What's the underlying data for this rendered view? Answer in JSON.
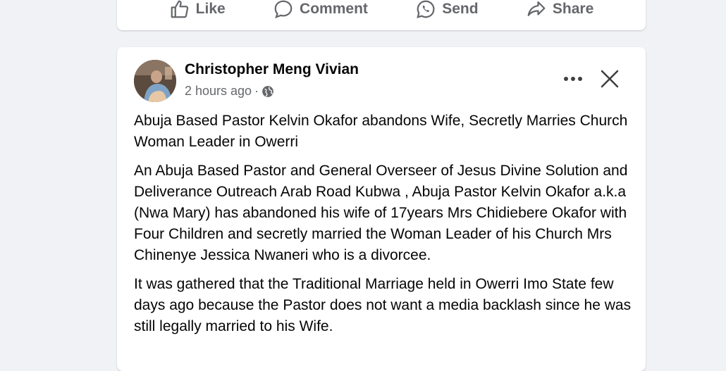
{
  "actions": {
    "like": "Like",
    "comment": "Comment",
    "send": "Send",
    "share": "Share"
  },
  "post": {
    "author": "Christopher Meng Vivian",
    "time": "2 hours ago",
    "separator": "·",
    "paragraphs": [
      "Abuja Based Pastor Kelvin Okafor abandons Wife, Secretly Marries Church Woman Leader in Owerri",
      "An Abuja Based Pastor and General Overseer of Jesus Divine Solution and Deliverance Outreach Arab Road Kubwa , Abuja Pastor Kelvin Okafor a.k.a (Nwa Mary) has abandoned his wife of 17years Mrs Chidiebere Okafor with Four Children and secretly married the Woman Leader of his Church Mrs Chinenye Jessica Nwaneri who is a divorcee.",
      "It was gathered that the Traditional Marriage held in Owerri Imo State few days ago because the Pastor does not want a media backlash since he was still legally married to his Wife."
    ]
  },
  "colors": {
    "background": "#f0f2f5",
    "card": "#ffffff",
    "secondary_text": "#65676b",
    "primary_text": "#050505"
  },
  "icons": [
    "like-icon",
    "comment-icon",
    "send-icon",
    "share-icon",
    "globe-icon",
    "more-options-icon",
    "close-icon"
  ]
}
